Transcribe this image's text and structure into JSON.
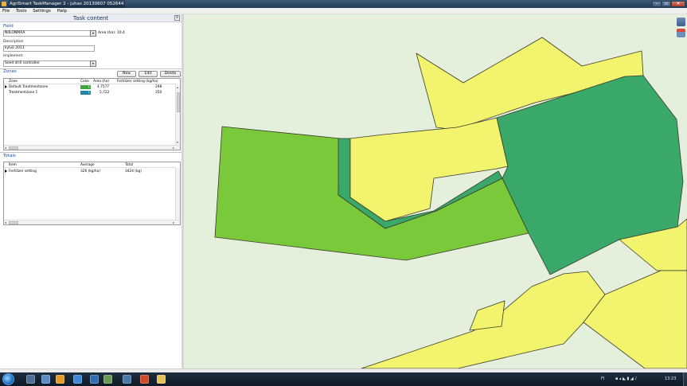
{
  "window": {
    "title": "AgriSmart TaskManager 2 - juhas 20130607 052644",
    "controls": {
      "minimize": "–",
      "maximize": "▫",
      "close": "✕"
    }
  },
  "menu": [
    "File",
    "Tools",
    "Settings",
    "Help"
  ],
  "panel": {
    "title": "Task content",
    "close": "x",
    "field": {
      "section_label": "Field",
      "value": "NIILONMAA",
      "area_label": "Area (ha):",
      "area_value": "10,4"
    },
    "description": {
      "label": "Description",
      "value": "kylvö 2013"
    },
    "implement": {
      "label": "Implement",
      "value": "Seed drill controller"
    },
    "zones": {
      "section_label": "Zones",
      "buttons": {
        "new": "New",
        "edit": "Edit",
        "delete": "Delete"
      },
      "columns": [
        "Zone",
        "Color",
        "Area (ha)",
        "Fertilizer setting (kg/ha)"
      ],
      "rows": [
        {
          "zone": "Default Treatmentzone",
          "color": "#3aa83a",
          "color_num": "1",
          "area": "4,7577",
          "fertilizer": "298"
        },
        {
          "zone": "Treatmentzone 1",
          "color": "#1c8aa6",
          "color_num": "1",
          "area": "5,722",
          "fertilizer": "350"
        }
      ]
    },
    "totals": {
      "section_label": "Totals",
      "columns": [
        "Item",
        "Average",
        "Total"
      ],
      "rows": [
        {
          "item": "Fertilizer setting",
          "average": "326 (kg/ha)",
          "total": "3424 (kg)"
        }
      ]
    }
  },
  "colors": {
    "map_background": "#e4efdc",
    "zone_yellow": "#f1f46c",
    "zone_light_green": "#7ac93a",
    "zone_dark_green": "#3aa869",
    "outline": "#3a3a2a"
  },
  "icons": [
    "start-orb-icon",
    "explorer-icon",
    "media-icon",
    "outlook-icon",
    "ie-icon",
    "app-icon",
    "agri-icon",
    "map-icon",
    "powerpoint-icon",
    "folder-icon"
  ],
  "tray": {
    "lang": "FI",
    "time": "13:23"
  }
}
